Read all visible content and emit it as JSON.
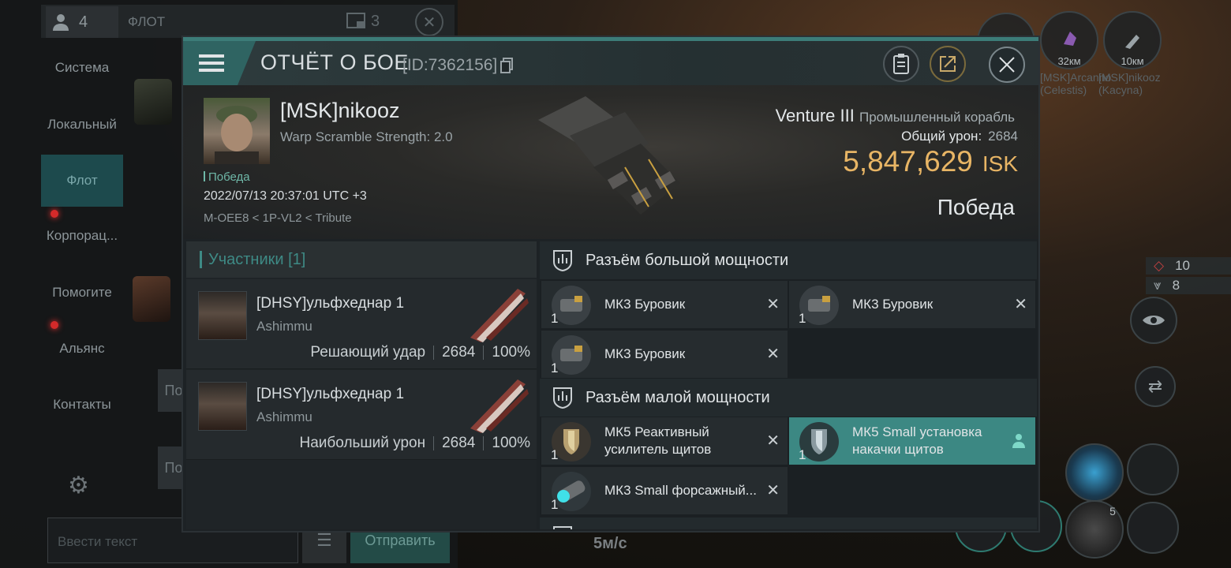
{
  "chat": {
    "member_count": "4",
    "channel_title": "ФЛОТ",
    "badge_count": "3",
    "channels": [
      "Система",
      "Локальный",
      "Флот",
      "Корпорац...",
      "Помогите",
      "Альянс",
      "Контакты"
    ],
    "input_placeholder": "Ввести текст",
    "send_label": "Отправить",
    "side_buttons": [
      "По",
      "По"
    ]
  },
  "hud": {
    "targets": [
      {
        "distance": "32км",
        "name": "[MSK]Arcanno (Celestis)"
      },
      {
        "distance": "10км",
        "name": "[MSK]nikooz (Kacyna)"
      }
    ],
    "stat_a": "10",
    "stat_b": "8",
    "speed": "5м/с",
    "module_badge": "5"
  },
  "report": {
    "title": "ОТЧЁТ О БОЕ",
    "id_text": "[ID:7362156]",
    "pilot_name": "[MSK]nikooz",
    "scram_text": "Warp Scramble Strength: 2.0",
    "victory_small": "Победа",
    "datetime": "2022/07/13 20:37:01 UTC +3",
    "location": "M-OEE8 < 1P-VL2 < Tribute",
    "ship_name": "Venture III",
    "ship_class": "Промышленный корабль",
    "total_damage_label": "Общий урон:",
    "total_damage": "2684",
    "isk_value": "5,847,629",
    "isk_unit": "ISK",
    "result": "Победа"
  },
  "participants": {
    "title": "Участники [1]",
    "rows": [
      {
        "name": "[DHSY]ульфхеднар 1",
        "ship": "Ashimmu",
        "label": "Решающий удар",
        "damage": "2684",
        "percent": "100%"
      },
      {
        "name": "[DHSY]ульфхеднар 1",
        "ship": "Ashimmu",
        "label": "Наибольший урон",
        "damage": "2684",
        "percent": "100%"
      }
    ]
  },
  "fitting": {
    "high_title": "Разъём большой мощности",
    "low_title": "Разъём малой мощности",
    "high_items": [
      {
        "qty": "1",
        "name": "МК3 Буровик"
      },
      {
        "qty": "1",
        "name": "МК3 Буровик"
      },
      {
        "qty": "1",
        "name": "МК3 Буровик"
      }
    ],
    "low_items": [
      {
        "qty": "1",
        "name": "МК5 Реактивный усилитель щитов"
      },
      {
        "qty": "1",
        "name": "МК5 Small установка  накачки щитов"
      },
      {
        "qty": "1",
        "name": "МК3 Small форсажный..."
      }
    ],
    "destroyed_mark": "✕"
  },
  "colors": {
    "accent": "#3c8883",
    "isk": "#e8b565",
    "victory": "#6fb8a8"
  }
}
